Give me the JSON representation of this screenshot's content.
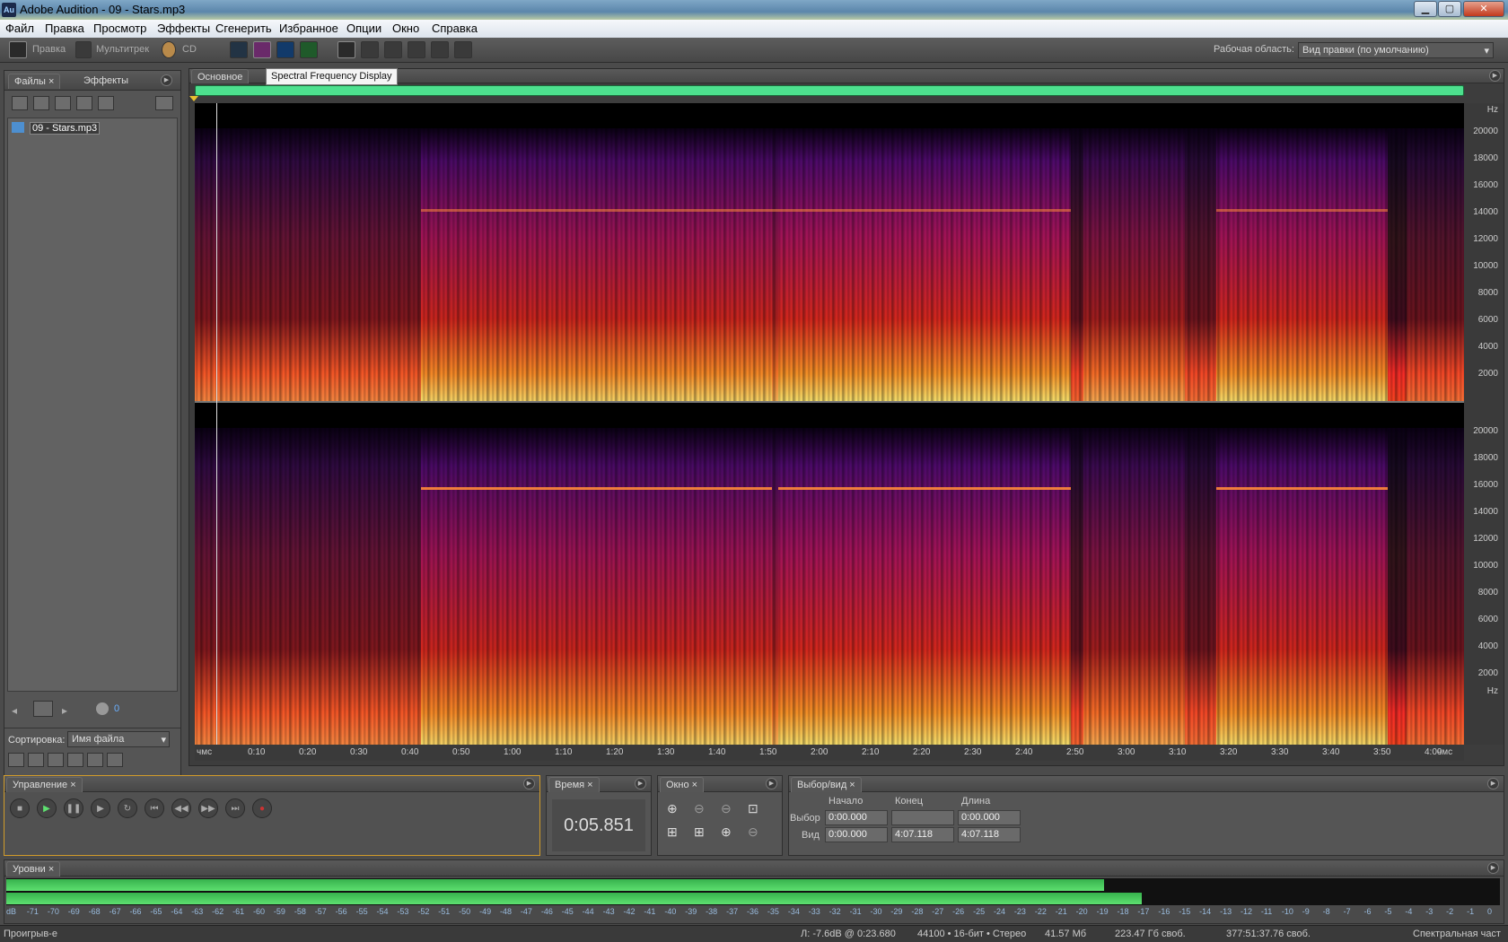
{
  "window": {
    "title": "Adobe Audition - 09 - Stars.mp3",
    "app_icon": "Au"
  },
  "menu": [
    "Файл",
    "Правка",
    "Просмотр",
    "Эффекты",
    "Сгенерить",
    "Избранное",
    "Опции",
    "Окно",
    "Справка"
  ],
  "toolbar": {
    "edit_label": "Правка",
    "multitrack_label": "Мультитрек",
    "cd_label": "CD",
    "workspace_label": "Рабочая область:",
    "workspace_value": "Вид правки (по умолчанию)"
  },
  "files_panel": {
    "tab_files": "Файлы",
    "tab_effects": "Эффекты",
    "file": "09 - Stars.mp3",
    "sort_label": "Сортировка:",
    "sort_value": "Имя файла",
    "volume_value": "0"
  },
  "editor": {
    "tab": "Основное",
    "tooltip": "Spectral Frequency Display",
    "freq_unit": "Hz",
    "freq_ticks": [
      "20000",
      "18000",
      "16000",
      "14000",
      "12000",
      "10000",
      "8000",
      "6000",
      "4000",
      "2000"
    ],
    "time_ticks": [
      "чмс",
      "0:10",
      "0:20",
      "0:30",
      "0:40",
      "0:50",
      "1:00",
      "1:10",
      "1:20",
      "1:30",
      "1:40",
      "1:50",
      "2:00",
      "2:10",
      "2:20",
      "2:30",
      "2:40",
      "2:50",
      "3:00",
      "3:10",
      "3:20",
      "3:30",
      "3:40",
      "3:50",
      "4:00",
      "чмс"
    ]
  },
  "transport": {
    "tab": "Управление"
  },
  "time": {
    "tab": "Время",
    "value": "0:05.851"
  },
  "window_panel": {
    "tab": "Окно"
  },
  "selection": {
    "tab": "Выбор/вид",
    "col_start": "Начало",
    "col_end": "Конец",
    "col_length": "Длина",
    "row_select": "Выбор",
    "row_view": "Вид",
    "select_start": "0:00.000",
    "select_end": "",
    "select_length": "0:00.000",
    "view_start": "0:00.000",
    "view_end": "4:07.118",
    "view_length": "4:07.118"
  },
  "levels": {
    "tab": "Уровни",
    "left_level": 0.735,
    "right_level": 0.76,
    "db_ticks": [
      "dB",
      "-71",
      "-70",
      "-69",
      "-68",
      "-67",
      "-66",
      "-65",
      "-64",
      "-63",
      "-62",
      "-61",
      "-60",
      "-59",
      "-58",
      "-57",
      "-56",
      "-55",
      "-54",
      "-53",
      "-52",
      "-51",
      "-50",
      "-49",
      "-48",
      "-47",
      "-46",
      "-45",
      "-44",
      "-43",
      "-42",
      "-41",
      "-40",
      "-39",
      "-38",
      "-37",
      "-36",
      "-35",
      "-34",
      "-33",
      "-32",
      "-31",
      "-30",
      "-29",
      "-28",
      "-27",
      "-26",
      "-25",
      "-24",
      "-23",
      "-22",
      "-21",
      "-20",
      "-19",
      "-18",
      "-17",
      "-16",
      "-15",
      "-14",
      "-13",
      "-12",
      "-11",
      "-10",
      "-9",
      "-8",
      "-7",
      "-6",
      "-5",
      "-4",
      "-3",
      "-2",
      "-1",
      "0"
    ]
  },
  "status": {
    "state": "Проигрыв-е",
    "level": "Л: -7.6dB @  0:23.680",
    "format": "44100 • 16-бит • Стерео",
    "size": "41.57 Мб",
    "free": "223.47 Гб своб.",
    "free_time": "377:51:37.76 своб.",
    "view": "Спектральная част"
  },
  "colors": {
    "accent": "#4de08e",
    "transport_border": "#d29c2a",
    "meter": "#5ee070"
  }
}
